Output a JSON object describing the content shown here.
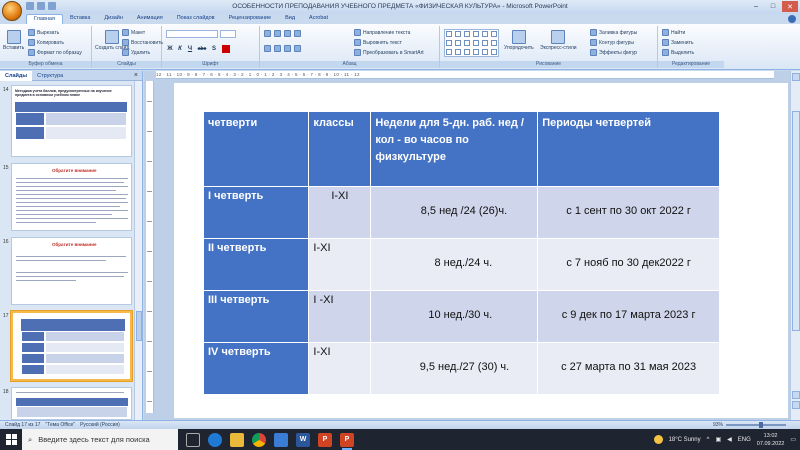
{
  "window": {
    "title": "ОСОБЕННОСТИ ПРЕПОДАВАНИЯ УЧЕБНОГО ПРЕДМЕТА «ФИЗИЧЕСКАЯ КУЛЬТУРА» - Microsoft PowerPoint",
    "minimize": "–",
    "maximize": "□",
    "close": "✕"
  },
  "ribbon": {
    "tabs": [
      "Главная",
      "Вставка",
      "Дизайн",
      "Анимация",
      "Показ слайдов",
      "Рецензирование",
      "Вид",
      "Acrobat"
    ],
    "active_tab": "Главная",
    "groups": {
      "clipboard": {
        "label": "Буфер обмена",
        "paste": "Вставить",
        "cut": "Вырезать",
        "copy": "Копировать",
        "format_painter": "Формат по образцу"
      },
      "slides": {
        "label": "Слайды",
        "new_slide": "Создать слайд",
        "layout": "Макет",
        "reset": "Восстановить",
        "delete": "Удалить"
      },
      "font": {
        "label": "Шрифт",
        "bold": "Ж",
        "italic": "К",
        "underline": "Ч",
        "strike": "abc",
        "shadow": "S"
      },
      "paragraph": {
        "label": "Абзац",
        "text_direction": "Направление текста",
        "align_text": "Выровнять текст",
        "smartart": "Преобразовать в SmartArt"
      },
      "drawing": {
        "label": "Рисование",
        "arrange": "Упорядочить",
        "quick_styles": "Экспресс-стили",
        "fill": "Заливка фигуры",
        "outline": "Контур фигуры",
        "effects": "Эффекты фигур"
      },
      "editing": {
        "label": "Редактирование",
        "find": "Найти",
        "replace": "Заменить",
        "select": "Выделить"
      }
    }
  },
  "left_pane": {
    "tab_slides": "Слайды",
    "tab_outline": "Структура",
    "close": "×",
    "thumbnails": [
      {
        "num": "14",
        "title": "Методика учета баллов, предусмотренных на изучение предмета в основном учебном плане"
      },
      {
        "num": "15",
        "heading": "Обратите внимание"
      },
      {
        "num": "16",
        "heading": "Обратите внимание"
      },
      {
        "num": "17"
      },
      {
        "num": "18"
      }
    ]
  },
  "ruler": {
    "marks": "12 · 11 · 10 · 9 · 8 · 7 · 6 · 5 · 4 · 3 · 2 · 1 · 0 · 1 · 2 · 3 · 4 · 5 · 6 · 7 · 8 · 9 · 10 · 11 · 12"
  },
  "table": {
    "headers": [
      "четверти",
      "классы",
      "Недели для 5-дн. раб. нед /кол - во часов по физкультуре",
      "Периоды четвертей"
    ],
    "rows": [
      {
        "quarter": "I четверть",
        "classes": "I-XI",
        "weeks": "8,5 нед /24 (26)ч.",
        "period": "с 1 сент по 30 окт 2022 г"
      },
      {
        "quarter": "II четверть",
        "classes": "I-XI",
        "weeks": "8 нед./24 ч.",
        "period": "с 7 нояб по 30 дек2022 г"
      },
      {
        "quarter": "III четверть",
        "classes": "I -XI",
        "weeks": "10 нед./30 ч.",
        "period": "с 9 дек по 17 марта 2023 г"
      },
      {
        "quarter": "IV четверть",
        "classes": "I-XI",
        "weeks": "9,5 нед./27 (30) ч.",
        "period": "с 27 марта по 31 мая 2023"
      }
    ]
  },
  "status": {
    "slide": "Слайд 17 из 17",
    "theme": "\"Тема Office\"",
    "language": "Русский (Россия)",
    "zoom": "93%"
  },
  "taskbar": {
    "search_placeholder": "Введите здесь текст для поиска",
    "weather": "18°C Sunny",
    "lang": "ENG",
    "time": "13:02",
    "date": "07.09.2022"
  }
}
